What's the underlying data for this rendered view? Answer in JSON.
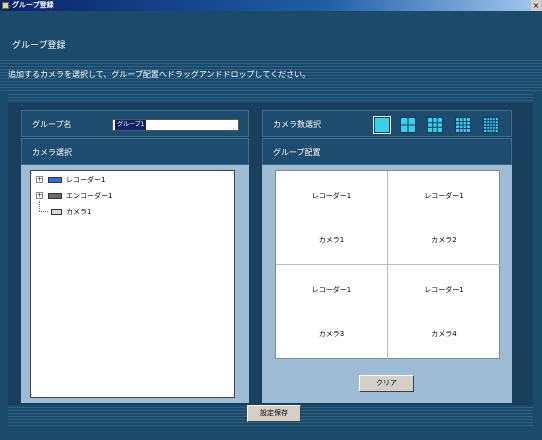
{
  "window": {
    "title": "グループ登録",
    "close_glyph": "×"
  },
  "header": {
    "title": "グループ登録"
  },
  "instruction": "追加するカメラを選択して、グループ配置へドラッグアンドドロップしてください。",
  "group_name": {
    "label": "グループ名",
    "value": "グループ1"
  },
  "camera_count": {
    "label": "カメラ数選択",
    "options": [
      "1",
      "4",
      "9",
      "16",
      "25"
    ]
  },
  "camera_select": {
    "label": "カメラ選択"
  },
  "tree": [
    {
      "label": "レコーダー1",
      "type": "recorder",
      "expander": "+"
    },
    {
      "label": "エンコーダー1",
      "type": "encoder",
      "expander": "+"
    },
    {
      "label": "カメラ1",
      "type": "camera"
    }
  ],
  "layout": {
    "label": "グループ配置",
    "cells": [
      {
        "recorder": "レコーダー1",
        "camera": "カメラ1"
      },
      {
        "recorder": "レコーダー1",
        "camera": "カメラ2"
      },
      {
        "recorder": "レコーダー1",
        "camera": "カメラ3"
      },
      {
        "recorder": "レコーダー1",
        "camera": "カメラ4"
      }
    ]
  },
  "buttons": {
    "clear": "クリア",
    "save": "設定保存"
  },
  "colors": {
    "background": "#1b4a6b",
    "panel_header": "#1e4c6e",
    "panel_body": "#9fbcd6",
    "selected_layout": "#3ad0e8"
  }
}
